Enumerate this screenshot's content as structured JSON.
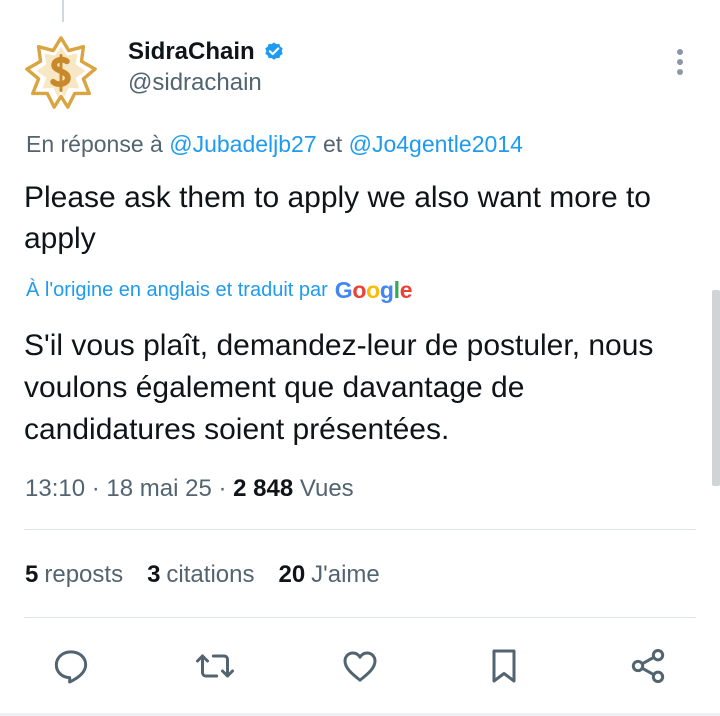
{
  "author": {
    "display_name": "SidraChain",
    "handle": "@sidrachain",
    "verified": true
  },
  "reply_to": {
    "prefix": "En réponse à ",
    "mention1": "@Jubadeljb27",
    "joiner": " et ",
    "mention2": "@Jo4gentle2014"
  },
  "tweet": {
    "text": "Please ask them to apply we also want more to apply"
  },
  "translation": {
    "label": "À l'origine en anglais et traduit par",
    "provider": "Google",
    "text": "S'il vous plaît, demandez-leur de postuler, nous voulons également que davantage de candidatures soient présentées."
  },
  "meta": {
    "time": "13:10",
    "sep1": " · ",
    "date": "18 mai 25",
    "sep2": " · ",
    "views_count": "2 848",
    "views_label": " Vues"
  },
  "stats": {
    "reposts_count": "5",
    "reposts_label": "reposts",
    "quotes_count": "3",
    "quotes_label": "citations",
    "likes_count": "20",
    "likes_label": "J'aime"
  },
  "colors": {
    "accent": "#1d9bf0",
    "muted": "#536471",
    "text": "#0f1419",
    "avatar_gold": "#d9a441"
  },
  "icons": [
    "verified-badge-icon",
    "more-options-icon",
    "reply-icon",
    "repost-icon",
    "like-icon",
    "bookmark-icon",
    "share-icon"
  ]
}
